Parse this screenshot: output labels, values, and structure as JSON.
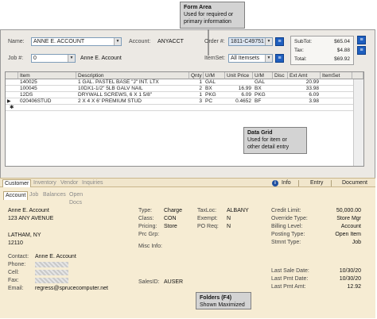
{
  "callouts": {
    "form_area": {
      "title": "Form Area",
      "lines": [
        "Used for required or",
        "primary information"
      ]
    },
    "data_grid": {
      "title": "Data Grid",
      "lines": [
        "Used for item or",
        "other detail entry"
      ]
    },
    "folders": {
      "title": "Folders (F4)",
      "lines": [
        "Shown Maximized"
      ]
    }
  },
  "form": {
    "name_label": "Name:",
    "name_value": "ANNE E. ACCOUNT",
    "account_label": "Account:",
    "account_value": "ANYACCT",
    "order_label": "Order #:",
    "order_value": "1811-C49751",
    "job_label": "Job #:",
    "job_value": "0",
    "job_name": "Anne E. Account",
    "itemset_label": "ItemSet:",
    "itemset_value": "All Itemsets"
  },
  "totals": {
    "subtot_label": "SubTot:",
    "subtot_value": "$65.04",
    "tax_label": "Tax:",
    "tax_value": "$4.88",
    "total_label": "Total:",
    "total_value": "$69.92"
  },
  "grid": {
    "headers": [
      "Item",
      "Description",
      "Qnty",
      "U/M",
      "Unit Price",
      "U/M",
      "Disc",
      "Ext Amt",
      "ItemSet"
    ],
    "rows": [
      {
        "item": "140025",
        "desc": "1 GAL. PASTEL BASE \"J\" INT. LTX",
        "qnty": "1",
        "um": "GAL",
        "price": "",
        "pum": "GAL",
        "disc": "",
        "ext": "20.99",
        "itemset": ""
      },
      {
        "item": "100045",
        "desc": "10DX1-1/2\" 5LB GALV NAIL",
        "qnty": "2",
        "um": "BX",
        "price": "16.99",
        "pum": "BX",
        "disc": "",
        "ext": "33.98",
        "itemset": ""
      },
      {
        "item": "12DS",
        "desc": "DRYWALL SCREWS, 6 X 1 5/8\"",
        "qnty": "1",
        "um": "PKG",
        "price": "6.09",
        "pum": "PKG",
        "disc": "",
        "ext": "6.09",
        "itemset": ""
      },
      {
        "item": "020406STUD",
        "desc": "2 X 4 X 6' PREMIUM STUD",
        "qnty": "3",
        "um": "PC",
        "price": "0.4652",
        "pum": "BF",
        "disc": "",
        "ext": "3.98",
        "itemset": ""
      }
    ],
    "new_row_marker": "✱"
  },
  "folder_tabs": {
    "customer": "Customer",
    "inventory": "Inventory",
    "vendor": "Vendor",
    "inquiries": "Inquiries",
    "info": "Info",
    "entry": "Entry",
    "document": "Document"
  },
  "sub_tabs": [
    "Account",
    "Job",
    "Balances",
    "Open Docs"
  ],
  "customer": {
    "name": "Anne E. Account",
    "address1": "123 ANY AVENUE",
    "city": "LATHAM, NY",
    "zip": "12110",
    "contact_label": "Contact:",
    "contact_value": "Anne E. Account",
    "phone_label": "Phone:",
    "cell_label": "Cell:",
    "fax_label": "Fax:",
    "email_label": "Email:",
    "email_value": "regress@sprucecomputer.net"
  },
  "mid": {
    "type_label": "Type:",
    "type_value": "Charge",
    "class_label": "Class:",
    "class_value": "CON",
    "pricing_label": "Pricing:",
    "pricing_value": "Store",
    "prcgrp_label": "Prc Grp:",
    "misc_label": "Misc Info:",
    "salesid_label": "SalesID:",
    "salesid_value": "AUSER",
    "taxloc_label": "TaxLoc:",
    "taxloc_value": "ALBANY",
    "exempt_label": "Exempt:",
    "exempt_value": "N",
    "po_label": "PO Req:",
    "po_value": "N"
  },
  "credit": {
    "limit_label": "Credit Limit:",
    "limit_value": "50,000.00",
    "override_label": "Override Type:",
    "override_value": "Store Mgr",
    "billing_label": "Billing Level:",
    "billing_value": "Account",
    "posting_label": "Posting Type:",
    "posting_value": "Open Item",
    "stmnt_label": "Stmnt Type:",
    "stmnt_value": "Job",
    "lastsale_label": "Last Sale Date:",
    "lastsale_value": "10/30/20",
    "lastpmt_label": "Last Pmt Date:",
    "lastpmt_value": "10/30/20",
    "lastamt_label": "Last Pmt Amt:",
    "lastamt_value": "12.92"
  }
}
